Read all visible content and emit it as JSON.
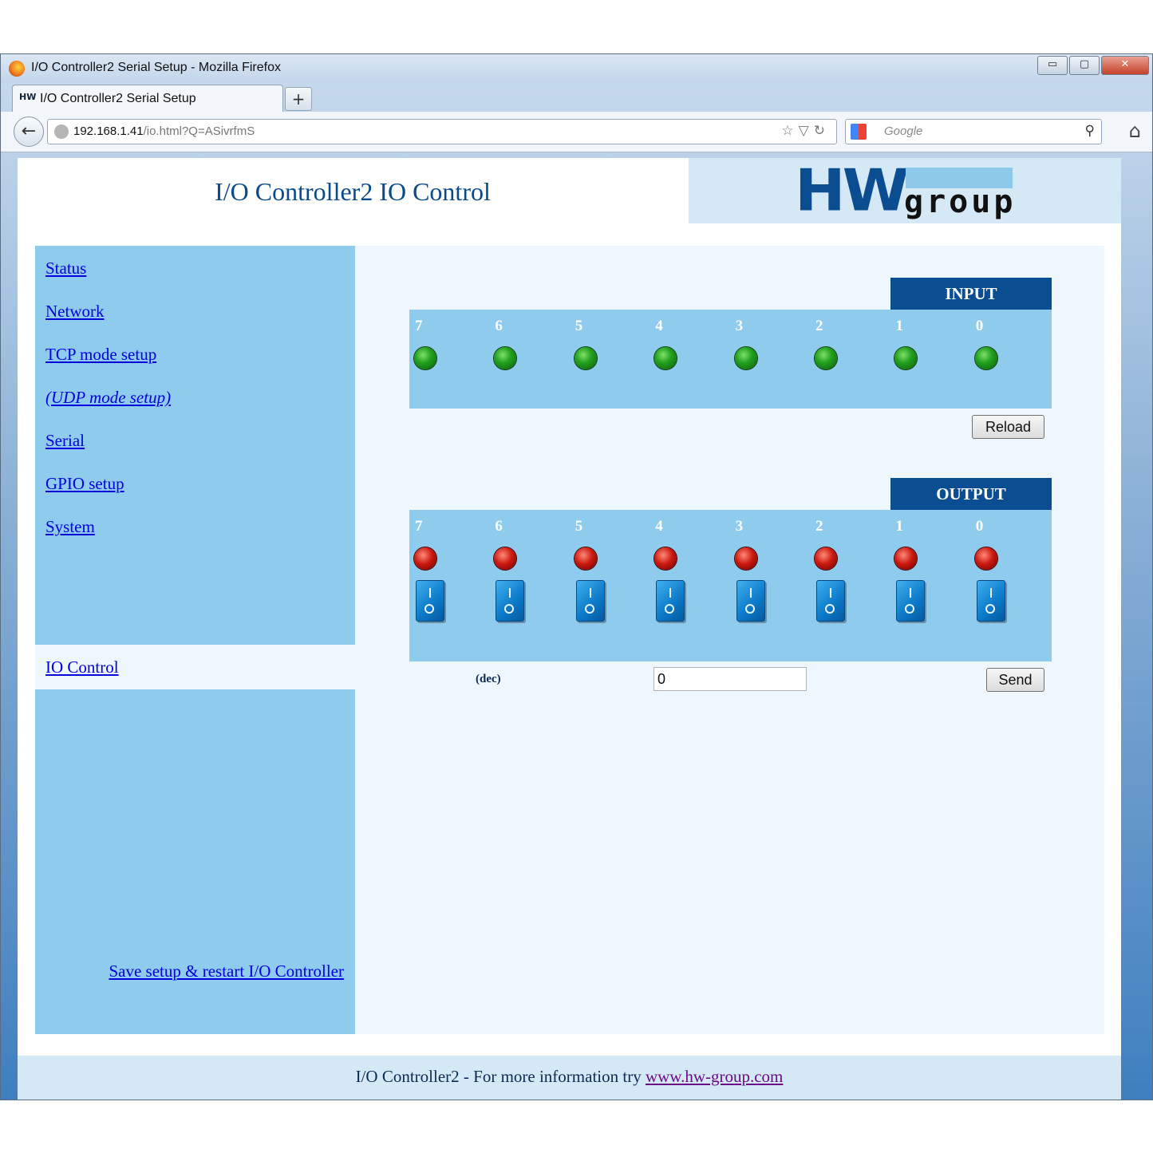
{
  "window": {
    "title": "I/O Controller2 Serial Setup - Mozilla Firefox",
    "controls": {
      "minimize": "▭",
      "maximize": "▢",
      "close": "✕"
    }
  },
  "tabs": [
    {
      "favicon_text": "HW",
      "label": "I/O Controller2 Serial Setup"
    }
  ],
  "new_tab_label": "+",
  "address_bar": {
    "host": "192.168.1.41",
    "path": "/io.html?Q=ASivrfmS"
  },
  "search_bar": {
    "placeholder": "Google"
  },
  "page": {
    "title": "I/O Controller2 IO Control",
    "logo": {
      "hw": "HW",
      "group": "group"
    }
  },
  "sidebar": {
    "items": [
      {
        "label": "Status",
        "italic": false
      },
      {
        "label": "Network",
        "italic": false
      },
      {
        "label": "TCP mode setup",
        "italic": false
      },
      {
        "label": "(UDP mode setup)",
        "italic": true
      },
      {
        "label": "Serial",
        "italic": false
      },
      {
        "label": "GPIO setup",
        "italic": false
      },
      {
        "label": "System",
        "italic": false
      }
    ],
    "active_item": "IO Control",
    "save_link": "Save setup & restart I/O Controller"
  },
  "input": {
    "heading": "INPUT",
    "bits": [
      "7",
      "6",
      "5",
      "4",
      "3",
      "2",
      "1",
      "0"
    ],
    "states": [
      "green",
      "green",
      "green",
      "green",
      "green",
      "green",
      "green",
      "green"
    ],
    "reload_button": "Reload"
  },
  "output": {
    "heading": "OUTPUT",
    "bits": [
      "7",
      "6",
      "5",
      "4",
      "3",
      "2",
      "1",
      "0"
    ],
    "states": [
      "red",
      "red",
      "red",
      "red",
      "red",
      "red",
      "red",
      "red"
    ],
    "dec_label": "(dec)",
    "dec_value": "0",
    "send_button": "Send"
  },
  "footer": {
    "text": "I/O Controller2 - For more information try",
    "link": "www.hw-group.com"
  },
  "colors": {
    "panel_bg": "#8ecbed",
    "heading_bg": "#0b4d91",
    "link": "#0000dd",
    "footer_link": "#6a0a8a"
  }
}
